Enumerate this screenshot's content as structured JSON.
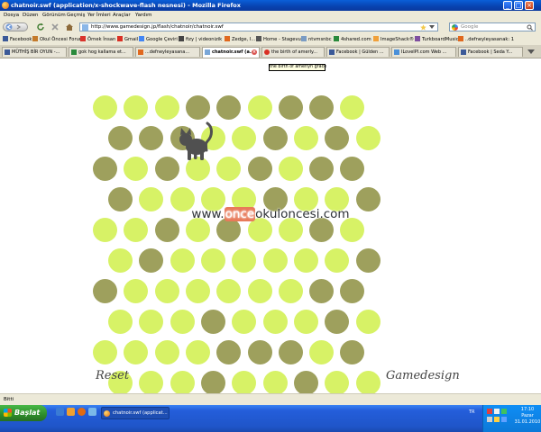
{
  "window": {
    "title": "chatnoir.swf (application/x-shockwave-flash nesnesi) - Mozilla Firefox",
    "controls": {
      "minimize": "_",
      "maximize": "□",
      "close": "×"
    }
  },
  "menu": [
    "Dosya",
    "Düzen",
    "Görünüm",
    "Geçmiş",
    "Yer İmleri",
    "Araçlar",
    "Yardım"
  ],
  "nav": {
    "url": "http://www.gamedesign.jp/flash/chatnoir/chatnoir.swf",
    "search_placeholder": "Google",
    "back_icon": "back-arrow-icon",
    "reload_icon": "reload-icon",
    "stop_icon": "stop-icon",
    "home_icon": "home-icon"
  },
  "bookmarks": [
    {
      "label": "Facebook",
      "color": "#3b5998"
    },
    {
      "label": "Okul Öncesi Forum",
      "color": "#c47a2c"
    },
    {
      "label": "Örnek İnsan",
      "color": "#d9332b"
    },
    {
      "label": "Gmail",
      "color": "#d93025"
    },
    {
      "label": "Google Çeviri",
      "color": "#4285f4"
    },
    {
      "label": "fizy | videonizik",
      "color": "#444444"
    },
    {
      "label": "Zedge, I...",
      "color": "#e0681e"
    },
    {
      "label": "Home - Stagevu",
      "color": "#555555"
    },
    {
      "label": "ntvmsnbc",
      "color": "#7a9cc4"
    },
    {
      "label": "4shared.com",
      "color": "#2a8a3c"
    },
    {
      "label": "ImageShack®",
      "color": "#f0a03a"
    },
    {
      "label": "TurkboardMusic",
      "color": "#7f4fa0"
    },
    {
      "label": "..defneyleyasanak: 1",
      "color": "#e0681e"
    }
  ],
  "tabs": [
    {
      "label": "MÜTHİŞ BİR OYUN -...",
      "active": false,
      "color": "#3b5998"
    },
    {
      "label": "gok hog kallama et...",
      "active": false,
      "color": "#2a8a3c"
    },
    {
      "label": "...defneyleyasana...",
      "active": false,
      "color": "#e0681e"
    },
    {
      "label": "chatnoir.swf (a...",
      "active": true,
      "color": "#7aa7d8"
    },
    {
      "label": "the birth of amerly...",
      "active": false,
      "color": "#d93025"
    },
    {
      "label": "Facebook | Gülden ...",
      "active": false,
      "color": "#3b5998"
    },
    {
      "label": "ILoveIPI.com Web ...",
      "active": false,
      "color": "#4a90d9"
    },
    {
      "label": "Facebook | Seda Y...",
      "active": false,
      "color": "#3b5998"
    }
  ],
  "tooltip": "the birth of amerlyn grace",
  "game": {
    "board": [
      "...OO.OO.",
      "OOO..O.O.",
      "O.O..O.OO",
      "O....O..O",
      "..O.O..O.",
      ".O......O",
      "O......OO",
      "...O...O.",
      "....OOO.O",
      "...O..O..",
      "..O......"
    ],
    "colors": {
      "open": "#d7f266",
      "blocked": "#9ea05d",
      "cat": "#505050"
    },
    "cat_position": {
      "row": 1,
      "col": 3
    },
    "watermark_prefix": "www.",
    "watermark_highlight": "once",
    "watermark_suffix": "okuloncesi.com",
    "reset_label": "Reset",
    "credit_label": "Gamedesign"
  },
  "status": "Bitti",
  "taskbar": {
    "start_label": "Başlat",
    "task_label": "chatnoir.swf (applicat...",
    "language": "TR",
    "clock_time": "17:10",
    "clock_day": "Pazar",
    "clock_date": "31.01.2010"
  }
}
